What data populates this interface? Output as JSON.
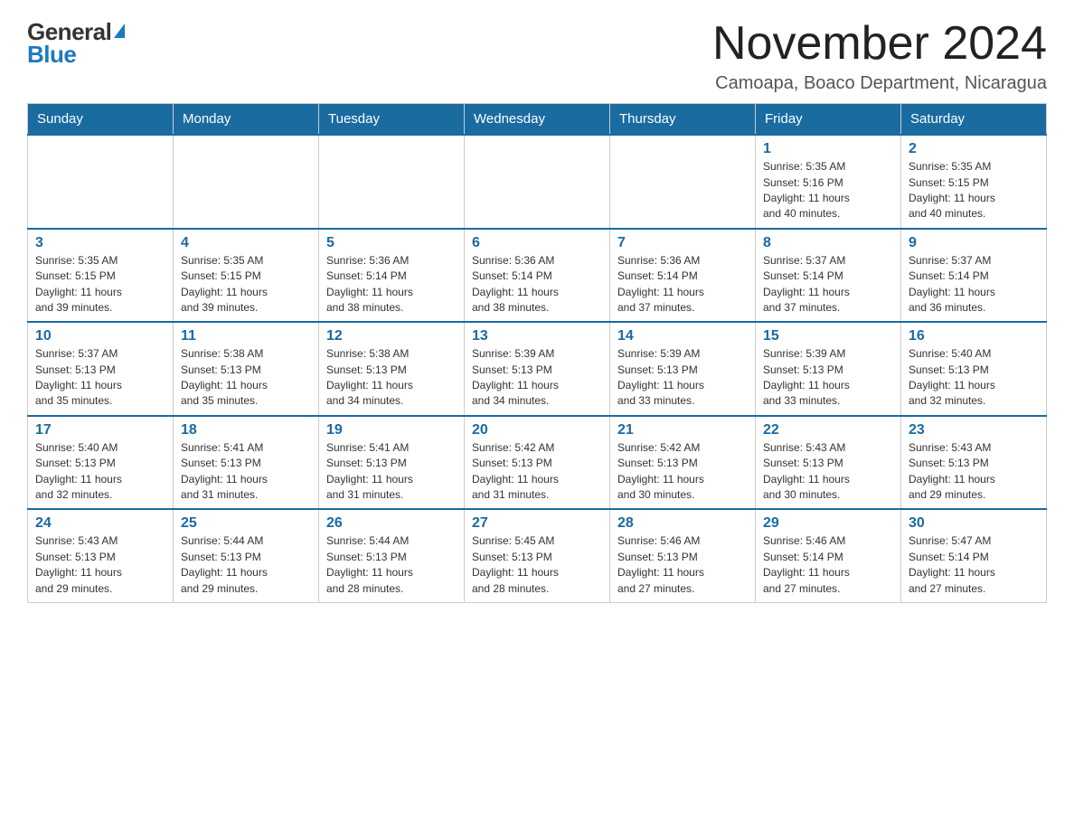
{
  "logo": {
    "general": "General",
    "blue": "Blue",
    "triangle": "▶"
  },
  "header": {
    "month_title": "November 2024",
    "location": "Camoapa, Boaco Department, Nicaragua"
  },
  "weekdays": [
    "Sunday",
    "Monday",
    "Tuesday",
    "Wednesday",
    "Thursday",
    "Friday",
    "Saturday"
  ],
  "weeks": [
    [
      {
        "day": "",
        "info": ""
      },
      {
        "day": "",
        "info": ""
      },
      {
        "day": "",
        "info": ""
      },
      {
        "day": "",
        "info": ""
      },
      {
        "day": "",
        "info": ""
      },
      {
        "day": "1",
        "info": "Sunrise: 5:35 AM\nSunset: 5:16 PM\nDaylight: 11 hours\nand 40 minutes."
      },
      {
        "day": "2",
        "info": "Sunrise: 5:35 AM\nSunset: 5:15 PM\nDaylight: 11 hours\nand 40 minutes."
      }
    ],
    [
      {
        "day": "3",
        "info": "Sunrise: 5:35 AM\nSunset: 5:15 PM\nDaylight: 11 hours\nand 39 minutes."
      },
      {
        "day": "4",
        "info": "Sunrise: 5:35 AM\nSunset: 5:15 PM\nDaylight: 11 hours\nand 39 minutes."
      },
      {
        "day": "5",
        "info": "Sunrise: 5:36 AM\nSunset: 5:14 PM\nDaylight: 11 hours\nand 38 minutes."
      },
      {
        "day": "6",
        "info": "Sunrise: 5:36 AM\nSunset: 5:14 PM\nDaylight: 11 hours\nand 38 minutes."
      },
      {
        "day": "7",
        "info": "Sunrise: 5:36 AM\nSunset: 5:14 PM\nDaylight: 11 hours\nand 37 minutes."
      },
      {
        "day": "8",
        "info": "Sunrise: 5:37 AM\nSunset: 5:14 PM\nDaylight: 11 hours\nand 37 minutes."
      },
      {
        "day": "9",
        "info": "Sunrise: 5:37 AM\nSunset: 5:14 PM\nDaylight: 11 hours\nand 36 minutes."
      }
    ],
    [
      {
        "day": "10",
        "info": "Sunrise: 5:37 AM\nSunset: 5:13 PM\nDaylight: 11 hours\nand 35 minutes."
      },
      {
        "day": "11",
        "info": "Sunrise: 5:38 AM\nSunset: 5:13 PM\nDaylight: 11 hours\nand 35 minutes."
      },
      {
        "day": "12",
        "info": "Sunrise: 5:38 AM\nSunset: 5:13 PM\nDaylight: 11 hours\nand 34 minutes."
      },
      {
        "day": "13",
        "info": "Sunrise: 5:39 AM\nSunset: 5:13 PM\nDaylight: 11 hours\nand 34 minutes."
      },
      {
        "day": "14",
        "info": "Sunrise: 5:39 AM\nSunset: 5:13 PM\nDaylight: 11 hours\nand 33 minutes."
      },
      {
        "day": "15",
        "info": "Sunrise: 5:39 AM\nSunset: 5:13 PM\nDaylight: 11 hours\nand 33 minutes."
      },
      {
        "day": "16",
        "info": "Sunrise: 5:40 AM\nSunset: 5:13 PM\nDaylight: 11 hours\nand 32 minutes."
      }
    ],
    [
      {
        "day": "17",
        "info": "Sunrise: 5:40 AM\nSunset: 5:13 PM\nDaylight: 11 hours\nand 32 minutes."
      },
      {
        "day": "18",
        "info": "Sunrise: 5:41 AM\nSunset: 5:13 PM\nDaylight: 11 hours\nand 31 minutes."
      },
      {
        "day": "19",
        "info": "Sunrise: 5:41 AM\nSunset: 5:13 PM\nDaylight: 11 hours\nand 31 minutes."
      },
      {
        "day": "20",
        "info": "Sunrise: 5:42 AM\nSunset: 5:13 PM\nDaylight: 11 hours\nand 31 minutes."
      },
      {
        "day": "21",
        "info": "Sunrise: 5:42 AM\nSunset: 5:13 PM\nDaylight: 11 hours\nand 30 minutes."
      },
      {
        "day": "22",
        "info": "Sunrise: 5:43 AM\nSunset: 5:13 PM\nDaylight: 11 hours\nand 30 minutes."
      },
      {
        "day": "23",
        "info": "Sunrise: 5:43 AM\nSunset: 5:13 PM\nDaylight: 11 hours\nand 29 minutes."
      }
    ],
    [
      {
        "day": "24",
        "info": "Sunrise: 5:43 AM\nSunset: 5:13 PM\nDaylight: 11 hours\nand 29 minutes."
      },
      {
        "day": "25",
        "info": "Sunrise: 5:44 AM\nSunset: 5:13 PM\nDaylight: 11 hours\nand 29 minutes."
      },
      {
        "day": "26",
        "info": "Sunrise: 5:44 AM\nSunset: 5:13 PM\nDaylight: 11 hours\nand 28 minutes."
      },
      {
        "day": "27",
        "info": "Sunrise: 5:45 AM\nSunset: 5:13 PM\nDaylight: 11 hours\nand 28 minutes."
      },
      {
        "day": "28",
        "info": "Sunrise: 5:46 AM\nSunset: 5:13 PM\nDaylight: 11 hours\nand 27 minutes."
      },
      {
        "day": "29",
        "info": "Sunrise: 5:46 AM\nSunset: 5:14 PM\nDaylight: 11 hours\nand 27 minutes."
      },
      {
        "day": "30",
        "info": "Sunrise: 5:47 AM\nSunset: 5:14 PM\nDaylight: 11 hours\nand 27 minutes."
      }
    ]
  ]
}
